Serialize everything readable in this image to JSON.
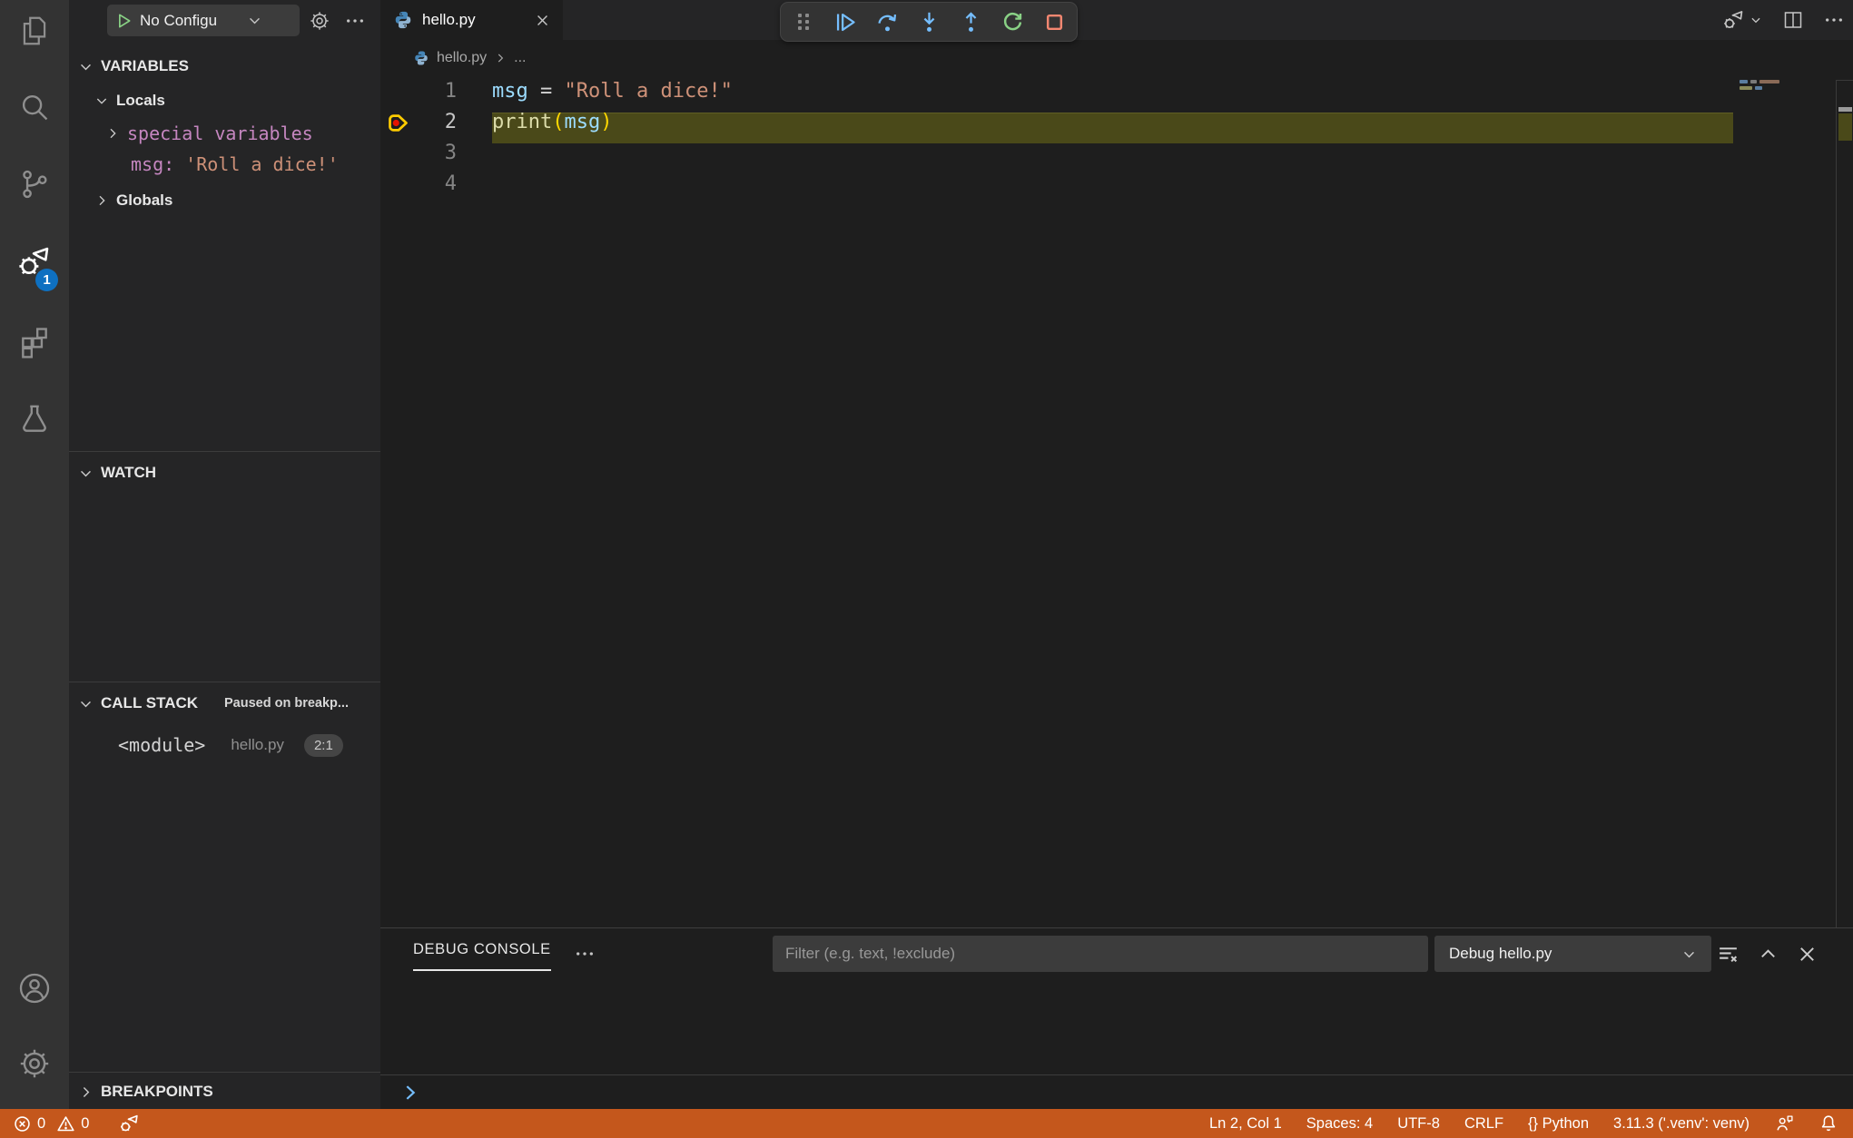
{
  "colors": {
    "status_bar_bg": "#C4571C",
    "badge_bg": "#0E70C1",
    "step_blue": "#75BEFF",
    "restart_green": "#89D185",
    "stop_red": "#F48771",
    "play_green": "#89D185",
    "ident_blue": "#9CDCFE",
    "operator_fg": "#D4D4D4",
    "string_orange": "#CE9178",
    "func_yellow": "#DCDCAA",
    "bracket_gold": "#FFD700",
    "var_violet": "#C586C0"
  },
  "activity_bar": {
    "debug_badge": "1"
  },
  "sidebar": {
    "config_label": "No Configu",
    "variables": {
      "header": "VARIABLES",
      "locals": "Locals",
      "special": "special variables",
      "msg_name": "msg:",
      "msg_value": "'Roll a dice!'",
      "globals": "Globals"
    },
    "watch": {
      "header": "WATCH"
    },
    "call_stack": {
      "header": "CALL STACK",
      "status": "Paused on breakp...",
      "frame_name": "<module>",
      "frame_file": "hello.py",
      "frame_location": "2:1"
    },
    "breakpoints": {
      "header": "BREAKPOINTS"
    }
  },
  "editor": {
    "tab_label": "hello.py",
    "breadcrumb_file": "hello.py",
    "breadcrumb_symbol": "...",
    "line_numbers": [
      "1",
      "2",
      "3",
      "4"
    ],
    "code": {
      "l1_var": "msg",
      "l1_op": " = ",
      "l1_str": "\"Roll a dice!\"",
      "l2_fn": "print",
      "l2_open": "(",
      "l2_arg": "msg",
      "l2_close": ")"
    }
  },
  "panel": {
    "title": "DEBUG CONSOLE",
    "filter_placeholder": "Filter (e.g. text, !exclude)",
    "session_label": "Debug hello.py"
  },
  "status_bar": {
    "errors": "0",
    "warnings": "0",
    "items": [
      "Ln 2, Col 1",
      "Spaces: 4",
      "UTF-8",
      "CRLF",
      "{} Python",
      "3.11.3 ('.venv': venv)"
    ]
  }
}
